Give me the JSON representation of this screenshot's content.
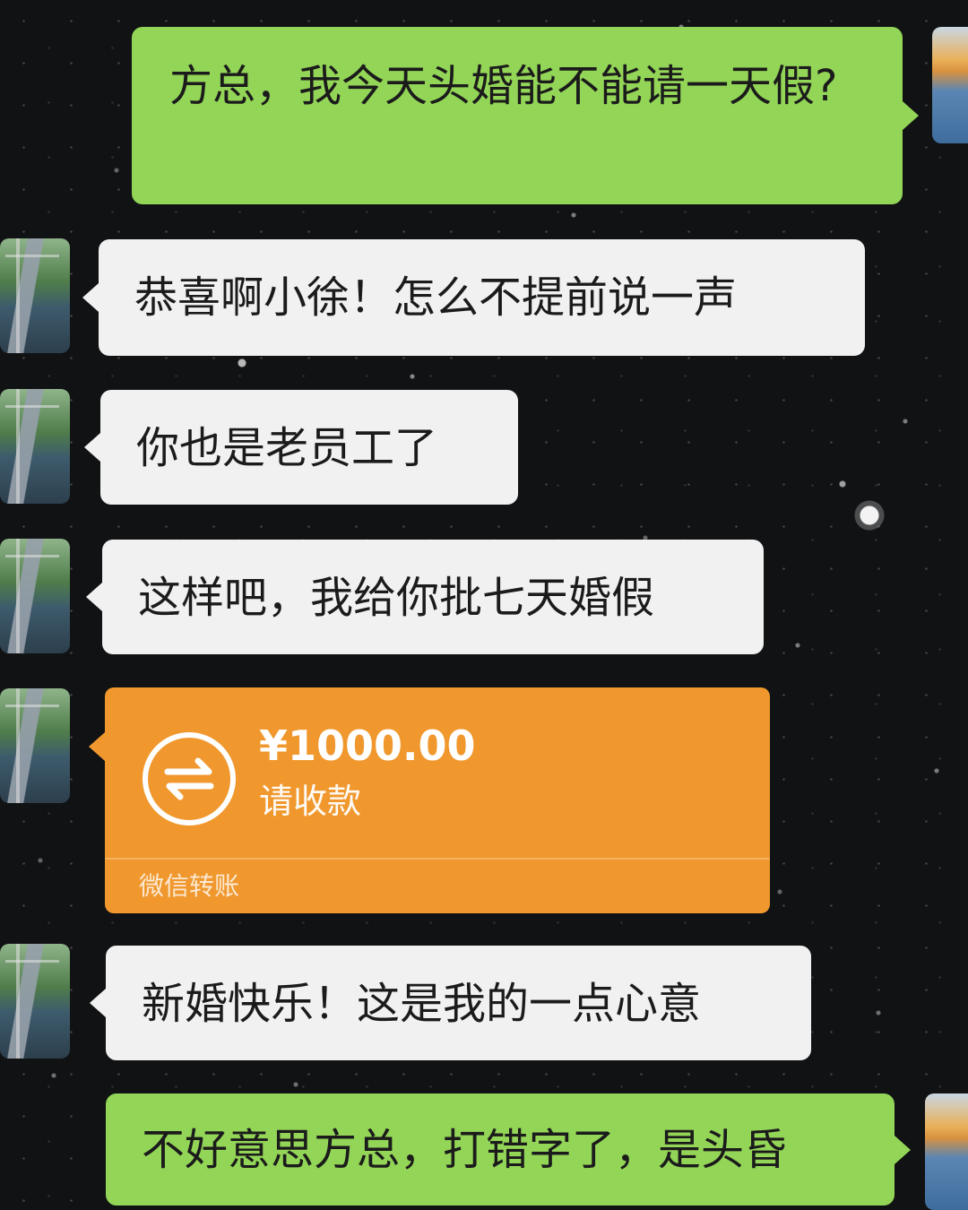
{
  "messages": [
    {
      "from": "self",
      "text": "方总，我今天头婚能不能请一天假?"
    },
    {
      "from": "boss",
      "text": "恭喜啊小徐！怎么不提前说一声"
    },
    {
      "from": "boss",
      "text": "你也是老员工了"
    },
    {
      "from": "boss",
      "text": "这样吧，我给你批七天婚假"
    },
    {
      "from": "boss",
      "type": "transfer",
      "amount": "¥1000.00",
      "status": "请收款",
      "source": "微信转账",
      "icon": "transfer-arrows-icon"
    },
    {
      "from": "boss",
      "text": "新婚快乐！这是我的一点心意"
    },
    {
      "from": "self",
      "text": "不好意思方总，打错字了，是头昏"
    }
  ],
  "colors": {
    "self_bubble": "#93d557",
    "other_bubble": "#f1f1f1",
    "transfer_card": "#f0982e",
    "background": "#101214"
  }
}
